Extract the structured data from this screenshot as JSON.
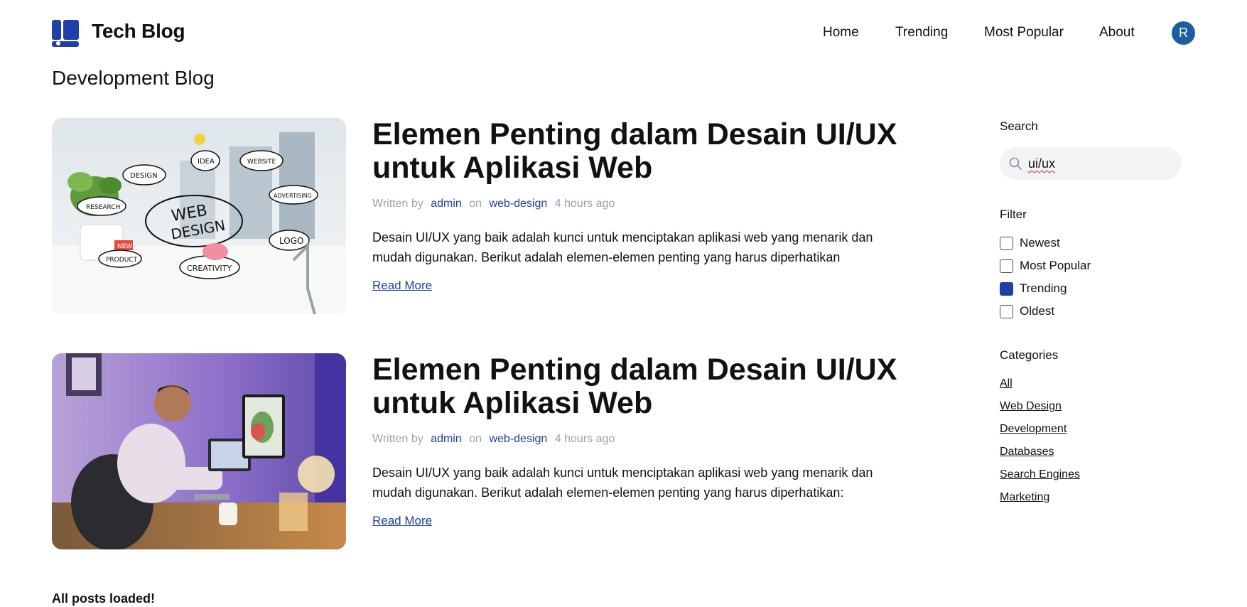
{
  "header": {
    "brand": "Tech Blog",
    "nav": [
      "Home",
      "Trending",
      "Most Popular",
      "About"
    ],
    "avatar_initial": "R",
    "accent_color": "#1c5da6"
  },
  "page_title": "Development Blog",
  "posts": [
    {
      "title": "Elemen Penting dalam Desain UI/UX untuk Aplikasi Web",
      "written_by_label": "Written by",
      "author": "admin",
      "on_label": "on",
      "category": "web-design",
      "time": "4 hours ago",
      "excerpt": "Desain UI/UX yang baik adalah kunci untuk menciptakan aplikasi web yang menarik dan mudah digunakan. Berikut adalah elemen-elemen penting yang harus diperhatikan",
      "read_more": "Read More",
      "image_labels": [
        "IDEA",
        "WEBSITE",
        "DESIGN",
        "WEB DESIGN",
        "ADVERTISING",
        "RESEARCH",
        "LOGO",
        "NEW",
        "PRODUCT",
        "CREATIVITY"
      ]
    },
    {
      "title": "Elemen Penting dalam Desain UI/UX untuk Aplikasi Web",
      "written_by_label": "Written by",
      "author": "admin",
      "on_label": "on",
      "category": "web-design",
      "time": "4 hours ago",
      "excerpt": "Desain UI/UX yang baik adalah kunci untuk menciptakan aplikasi web yang menarik dan mudah digunakan. Berikut adalah elemen-elemen penting yang harus diperhatikan:",
      "read_more": "Read More"
    }
  ],
  "sidebar": {
    "search_label": "Search",
    "search_value": "ui/ux",
    "filter_label": "Filter",
    "filters": [
      {
        "label": "Newest",
        "checked": false
      },
      {
        "label": "Most Popular",
        "checked": false
      },
      {
        "label": "Trending",
        "checked": true
      },
      {
        "label": "Oldest",
        "checked": false
      }
    ],
    "categories_label": "Categories",
    "categories": [
      "All",
      "Web Design",
      "Development",
      "Databases",
      "Search Engines",
      "Marketing"
    ]
  },
  "status": "All posts loaded!"
}
